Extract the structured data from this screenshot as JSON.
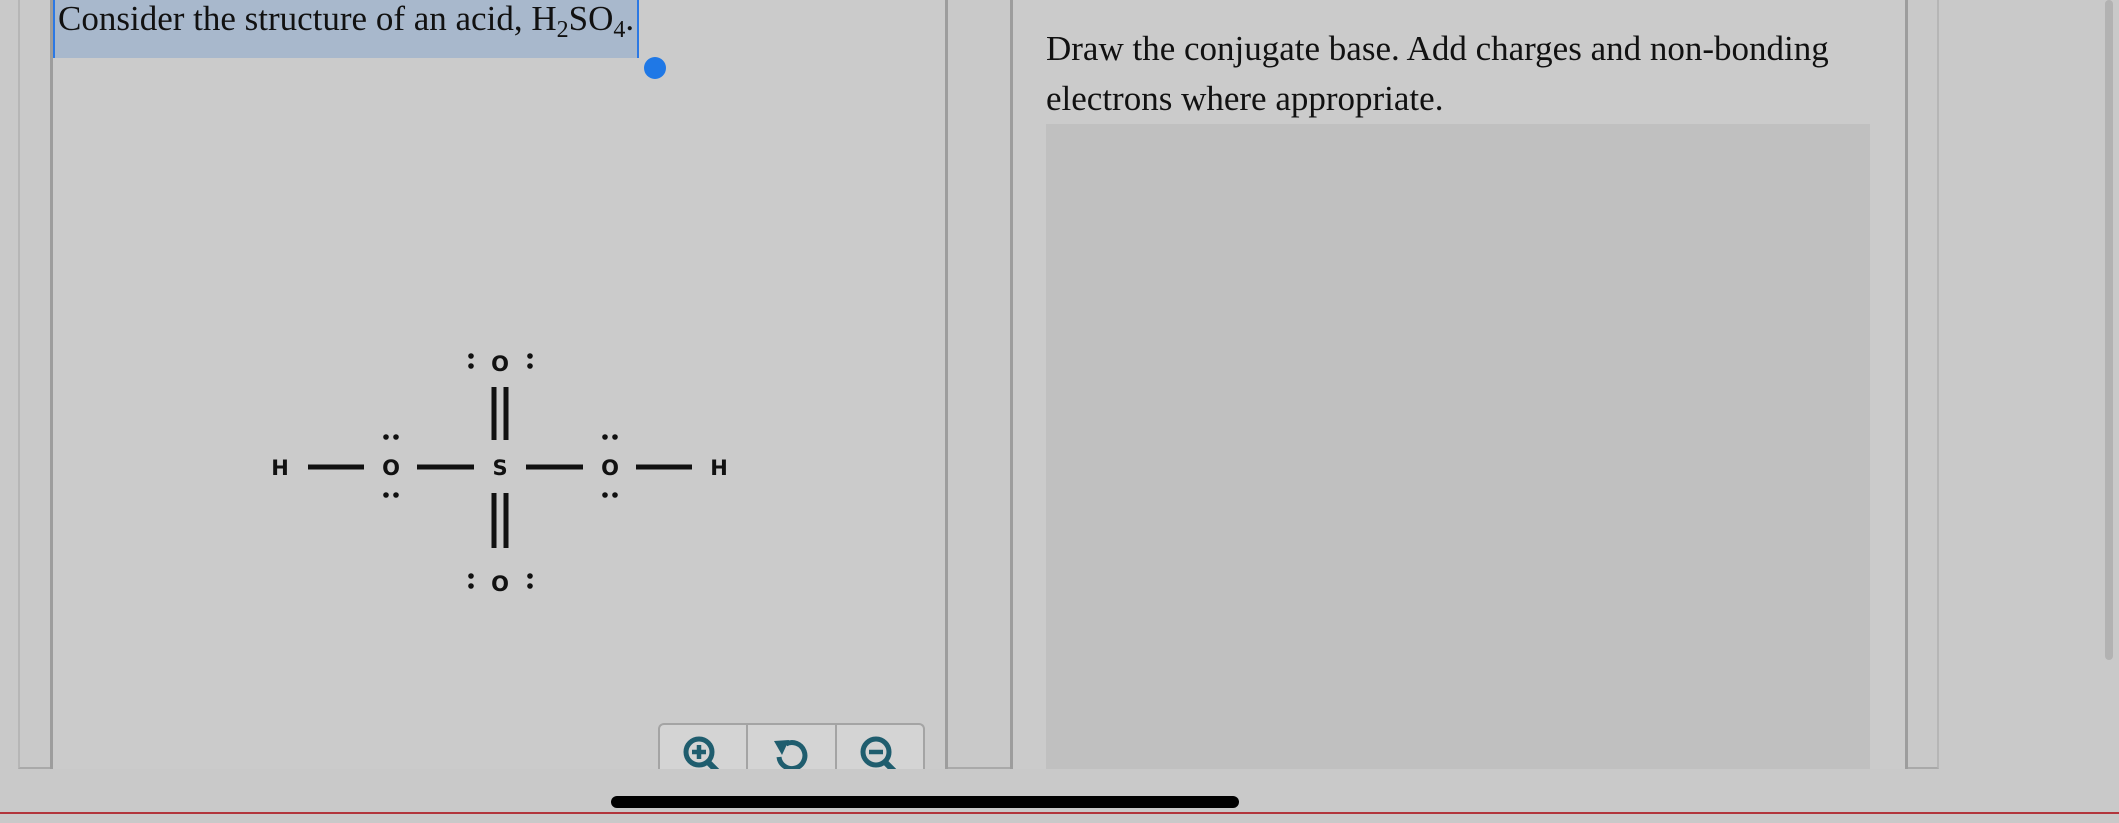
{
  "question": {
    "prefix": "Consider the structure of an acid, H",
    "sub1": "2",
    "mid": "SO",
    "sub2": "4",
    "suffix": "."
  },
  "molecule": {
    "labels": {
      "h_left": "H",
      "o_left": "O",
      "s_center": "S",
      "o_right": "O",
      "h_right": "H",
      "o_top": "O",
      "o_bottom": "O"
    }
  },
  "toolbar": {
    "zoom_in_icon": "zoom-in-icon",
    "reset_icon": "reset-icon",
    "zoom_out_icon": "zoom-out-icon",
    "icon_color": "#1f5d6e"
  },
  "instructions": {
    "text": "Draw the conjugate base. Add charges and non-bonding electrons where appropriate."
  },
  "colors": {
    "selection": "#a8b8cc",
    "selection_handle": "#1f78e6"
  }
}
